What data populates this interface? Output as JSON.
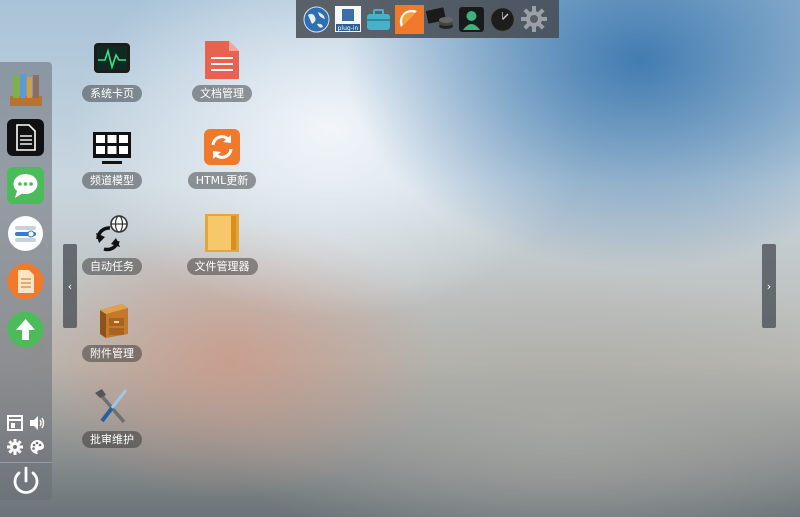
{
  "top_dock": {
    "items": [
      "globe-icon",
      "plugin-icon",
      "toolbox-icon",
      "orange-slice-icon",
      "card-coins-icon",
      "user-icon",
      "clock-icon",
      "gear-icon"
    ],
    "plugin_label": "plug-in"
  },
  "sidebar": {
    "apps": [
      "books-icon",
      "document-icon",
      "chat-icon",
      "toggles-icon",
      "note-icon",
      "upload-icon"
    ],
    "mini": [
      "window-icon",
      "speaker-icon",
      "settings-icon",
      "palette-icon"
    ],
    "power": "power-icon"
  },
  "desktop": {
    "icons": [
      {
        "label": "系统卡页",
        "icon": "monitor-pulse-icon"
      },
      {
        "label": "文档管理",
        "icon": "document-red-icon"
      },
      {
        "label": "频道模型",
        "icon": "screen-grid-icon"
      },
      {
        "label": "HTML更新",
        "icon": "refresh-icon"
      },
      {
        "label": "自动任务",
        "icon": "globe-cycle-icon"
      },
      {
        "label": "文件管理器",
        "icon": "folder-icon"
      },
      {
        "label": "附件管理",
        "icon": "cabinet-icon"
      },
      {
        "label": "批审维护",
        "icon": "tools-icon"
      }
    ]
  },
  "nav": {
    "prev": "‹",
    "next": "›"
  },
  "colors": {
    "orange": "#f0792b",
    "green": "#4cbb5a",
    "red": "#e8624f"
  }
}
